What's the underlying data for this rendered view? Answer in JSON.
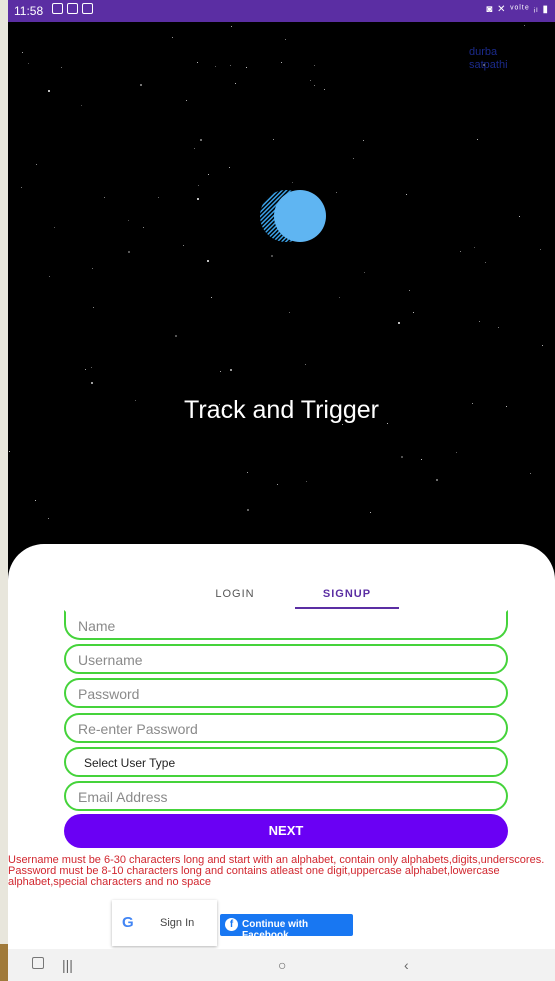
{
  "status_bar": {
    "time": "11:58",
    "right_icons": "◙ ✕ ᵛᵒˡᵗᵉ ᵢₗ ▮"
  },
  "user_name": "durba satpathi",
  "app_title": "Track and Trigger",
  "tabs": [
    {
      "label": "LOGIN",
      "active": false
    },
    {
      "label": "SIGNUP",
      "active": true
    }
  ],
  "form": {
    "name_placeholder": "Name",
    "username_placeholder": "Username",
    "password_placeholder": "Password",
    "reenter_placeholder": "Re-enter Password",
    "user_type_selected": "Select User Type",
    "email_placeholder": "Email Address",
    "next_label": "NEXT"
  },
  "hints": {
    "username": "Username must be 6-30 characters long and start with an alphabet, contain only alphabets,digits,underscores.",
    "password": "Password must be 8-10 characters long and contains atleast one digit,uppercase alphabet,lowercase alphabet,special characters and no space"
  },
  "social": {
    "google_glyph": "G",
    "google_label": "Sign In",
    "facebook_glyph": "f",
    "facebook_label": "Continue with Facebook"
  },
  "nav": {
    "recent_glyph": "|||",
    "home_glyph": "○",
    "back_glyph": "‹"
  },
  "colors": {
    "status_bar": "#5b2ea3",
    "accent": "#6a00f4",
    "field_border": "#45d33b",
    "error_text": "#d1272f",
    "facebook": "#1877f2"
  }
}
